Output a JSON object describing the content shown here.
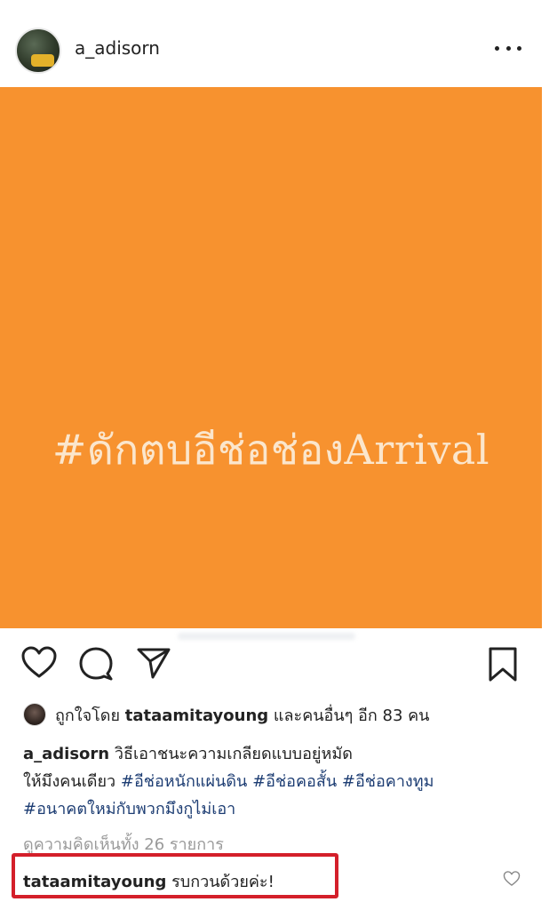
{
  "header": {
    "username": "a_adisorn",
    "more_icon": "more-horizontal-icon"
  },
  "post": {
    "image_text": "#ดักตบอีช่อช่องArrival",
    "image_color": "#f7922f",
    "image_text_color": "#fbe6cc"
  },
  "actions": {
    "like_icon": "heart-icon",
    "comment_icon": "comment-icon",
    "share_icon": "paper-plane-icon",
    "save_icon": "bookmark-icon"
  },
  "likes": {
    "prefix": "ถูกใจโดย",
    "user": "tataamitayoung",
    "suffix": "และคนอื่นๆ อีก 83 คน"
  },
  "caption": {
    "user": "a_adisorn",
    "line1": "วิธีเอาชนะความเกลียดแบบอยู่หมัด",
    "line2_plain": "ให้มึงคนเดียว",
    "tag1": "#อีช่อหนักแผ่นดิน",
    "tag2": "#อีช่อคอสั้น",
    "tag3": "#อีช่อคางทูม",
    "tag4": "#อนาคตใหม่กับพวกมึงกูไม่เอา"
  },
  "view_comments": "ดูความคิดเห็นทั้ง 26 รายการ",
  "comment": {
    "user": "tataamitayoung",
    "text": "รบกวนด้วยค่ะ!",
    "highlight_color": "#d41f2a"
  },
  "colors": {
    "hashtag": "#1d3d73",
    "muted": "#9a9a9a"
  }
}
